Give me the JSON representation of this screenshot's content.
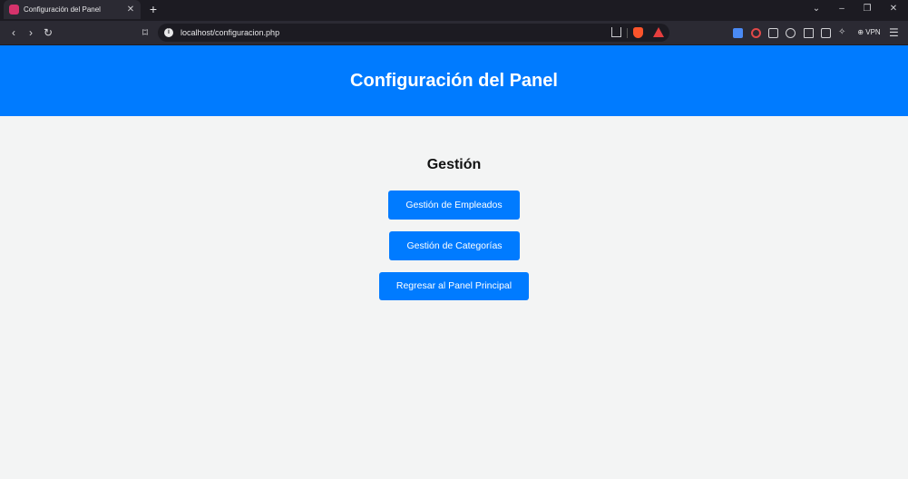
{
  "browser": {
    "tab": {
      "title": "Configuración del Panel",
      "close_glyph": "✕"
    },
    "new_tab_glyph": "+",
    "window_controls": {
      "dropdown": "⌄",
      "minimize": "–",
      "restore": "❐",
      "close": "✕"
    },
    "nav": {
      "back": "‹",
      "forward": "›",
      "reload": "↻",
      "bookmark": "⌑"
    },
    "url": "localhost/configuracion.php",
    "info_glyph": "i",
    "vpn_label": "⊕ VPN",
    "menu_glyph": "☰",
    "leo_glyph": "✧",
    "icons": [
      "info-icon",
      "share-icon",
      "brave-shields-icon",
      "brave-rewards-icon",
      "translate-icon",
      "record-icon",
      "extensions-icon",
      "spiral-icon",
      "sidebar-icon",
      "wallet-icon",
      "leo-icon",
      "vpn-icon",
      "menu-icon"
    ],
    "colors": {
      "tabbar": "#1c1b22",
      "toolbar": "#2b2a33"
    }
  },
  "page": {
    "header": {
      "title": "Configuración del Panel"
    },
    "section": {
      "title": "Gestión"
    },
    "buttons": {
      "employees": "Gestión de Empleados",
      "categories": "Gestión de Categorías",
      "back": "Regresar al Panel Principal"
    },
    "colors": {
      "primary": "#007bff",
      "background": "#f3f4f4"
    }
  }
}
